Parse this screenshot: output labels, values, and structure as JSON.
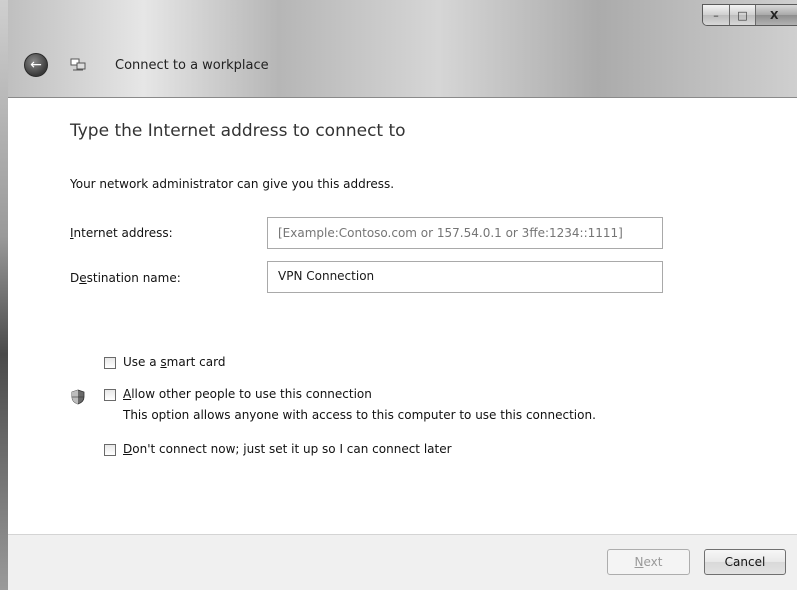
{
  "window": {
    "title": "Connect to a workplace",
    "caption_buttons": {
      "minimize": "–",
      "maximize": "□",
      "close": "X"
    }
  },
  "page": {
    "heading": "Type the Internet address to connect to",
    "hint": "Your network administrator can give you this address."
  },
  "form": {
    "internet_address": {
      "label_mnemonic": "I",
      "label_rest": "nternet address:",
      "value": "",
      "placeholder": "[Example:Contoso.com or 157.54.0.1 or 3ffe:1234::1111]"
    },
    "destination_name": {
      "label_pre": "D",
      "label_mnemonic": "e",
      "label_rest": "stination name:",
      "value": "VPN Connection"
    }
  },
  "options": {
    "smart_card": {
      "pre": "Use a ",
      "mnemonic": "s",
      "rest": "mart card",
      "checked": false
    },
    "allow_others": {
      "mnemonic": "A",
      "rest": "llow other people to use this connection",
      "description": "This option allows anyone with access to this computer to use this connection.",
      "checked": false
    },
    "dont_connect": {
      "mnemonic": "D",
      "rest": "on't connect now; just set it up so I can connect later",
      "checked": false
    }
  },
  "icons": {
    "back": "back-arrow-icon",
    "wizard": "network-connection-icon",
    "shield": "uac-shield-icon"
  },
  "buttons": {
    "next_mnemonic": "N",
    "next_rest": "ext",
    "next_enabled": false,
    "cancel": "Cancel"
  }
}
